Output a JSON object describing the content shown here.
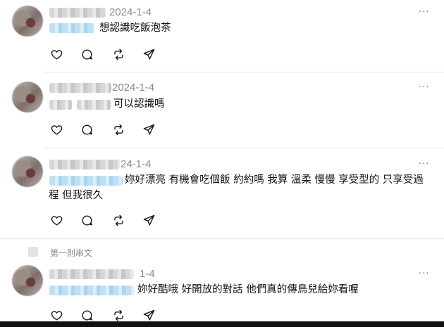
{
  "posts": [
    {
      "date": "2024-1-4",
      "text": "想認識吃飯泡茶",
      "more": "···"
    },
    {
      "date": "2024-1-4",
      "text": "可以認識嗎",
      "more": "···"
    },
    {
      "date": "24-1-4",
      "text_line1": "妳好漂亮 有機會吃個飯 約約嗎 我算 溫柔 慢慢 享受型的 只享受過",
      "text_line2": "程 但我很久",
      "more": "···"
    },
    {
      "date": "1-4",
      "text": "妳好酷哦 好開放的對話 他們真的傳鳥兒給妳看喔",
      "more": "···"
    }
  ],
  "section_label": "第一則串文",
  "icons": [
    "heart-icon",
    "comment-icon",
    "repost-icon",
    "share-icon"
  ]
}
